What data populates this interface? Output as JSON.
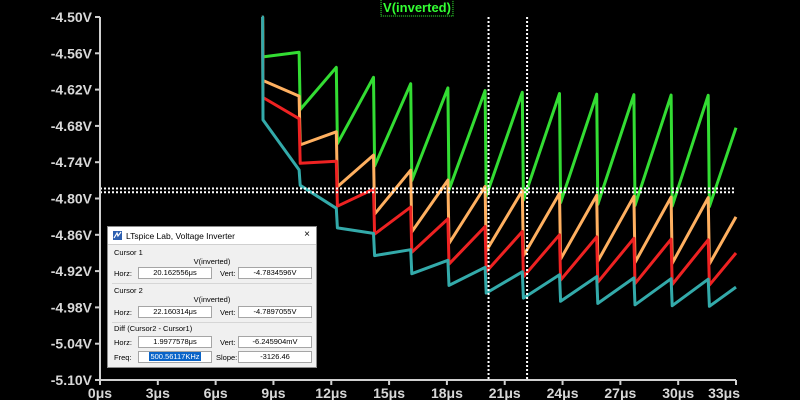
{
  "chart_data": {
    "type": "line",
    "title": "V(inverted)",
    "xlabel": "",
    "ylabel": "",
    "xlim": [
      0,
      33
    ],
    "ylim": [
      -5.1,
      -4.5
    ],
    "x_tick_labels": [
      "0μs",
      "3μs",
      "6μs",
      "9μs",
      "12μs",
      "15μs",
      "18μs",
      "21μs",
      "24μs",
      "27μs",
      "30μs",
      "33μs"
    ],
    "y_tick_labels": [
      "-4.50V",
      "-4.56V",
      "-4.62V",
      "-4.68V",
      "-4.74V",
      "-4.80V",
      "-4.86V",
      "-4.92V",
      "-4.98V",
      "-5.04V",
      "-5.10V"
    ],
    "grid": false,
    "series": [
      {
        "color": "#33dd33",
        "start_x": 8.4,
        "start_y": -4.5,
        "period": 1.93,
        "peak_first": -4.52,
        "peak_steady": -4.63,
        "low_first": -4.566,
        "low_steady": -4.815,
        "tau": 4.5,
        "end_y": -4.77
      },
      {
        "color": "#ffb060",
        "start_x": 8.4,
        "start_y": -4.5,
        "period": 1.93,
        "peak_first": -4.54,
        "peak_steady": -4.8,
        "low_first": -4.605,
        "low_steady": -4.91,
        "tau": 4.5,
        "end_y": -4.87
      },
      {
        "color": "#ee2222",
        "start_x": 8.4,
        "start_y": -4.5,
        "period": 1.93,
        "peak_first": -4.56,
        "peak_steady": -4.87,
        "low_first": -4.633,
        "low_steady": -4.945,
        "tau": 4.5,
        "end_y": -4.92
      },
      {
        "color": "#33aaaa",
        "start_x": 8.4,
        "start_y": -4.5,
        "period": 1.93,
        "peak_first": -4.655,
        "peak_steady": -4.935,
        "low_first": -4.67,
        "low_steady": -4.98,
        "tau": 4.5,
        "end_y": -4.97
      }
    ],
    "cursors": {
      "vertical_x": [
        20.16,
        22.16
      ],
      "horizontal_y": [
        -4.7835,
        -4.7897
      ],
      "color": "#ffffff"
    }
  },
  "dialog": {
    "title": "LTspice Lab, Voltage Inverter",
    "close": "×",
    "cursor1_header": "Cursor 1",
    "cursor1_trace": "V(inverted)",
    "cursor1_horz_label": "Horz:",
    "cursor1_horz": "20.162556μs",
    "cursor1_vert_label": "Vert:",
    "cursor1_vert": "-4.7834596V",
    "cursor2_header": "Cursor 2",
    "cursor2_trace": "V(inverted)",
    "cursor2_horz_label": "Horz:",
    "cursor2_horz": "22.160314μs",
    "cursor2_vert_label": "Vert:",
    "cursor2_vert": "-4.7897055V",
    "diff_header": "Diff (Cursor2 - Cursor1)",
    "diff_horz_label": "Horz:",
    "diff_horz": "1.9977578μs",
    "diff_vert_label": "Vert:",
    "diff_vert": "-6.245904mV",
    "freq_label": "Freq:",
    "freq": "500.56117KHz",
    "slope_label": "Slope:",
    "slope": "-3126.46"
  }
}
